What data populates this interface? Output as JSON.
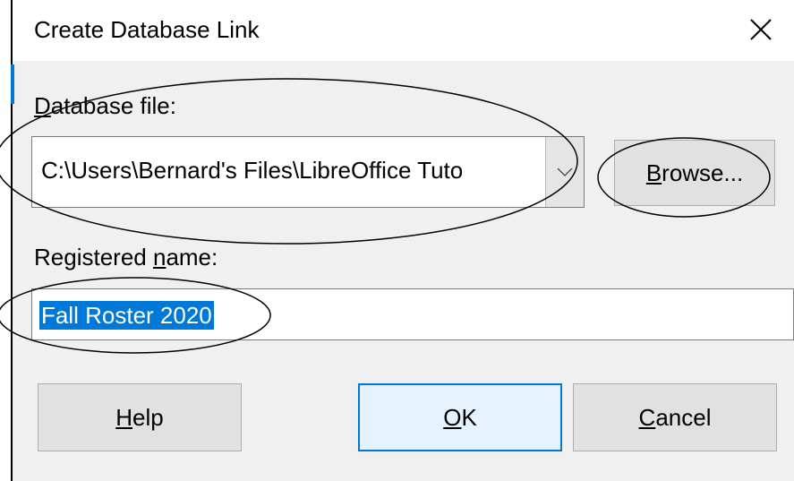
{
  "dialog": {
    "title": "Create Database Link",
    "close_icon": "close-icon"
  },
  "database_file": {
    "label": "Database file:",
    "value": "C:\\Users\\Bernard's Files\\LibreOffice Tuto",
    "browse_label": "Browse..."
  },
  "registered_name": {
    "label": "Registered name:",
    "value": "Fall Roster 2020"
  },
  "buttons": {
    "help": "Help",
    "ok": "OK",
    "cancel": "Cancel"
  },
  "colors": {
    "accent": "#0078d7",
    "dialog_background": "#f0f0f0",
    "annotation_ink": "#000000"
  }
}
